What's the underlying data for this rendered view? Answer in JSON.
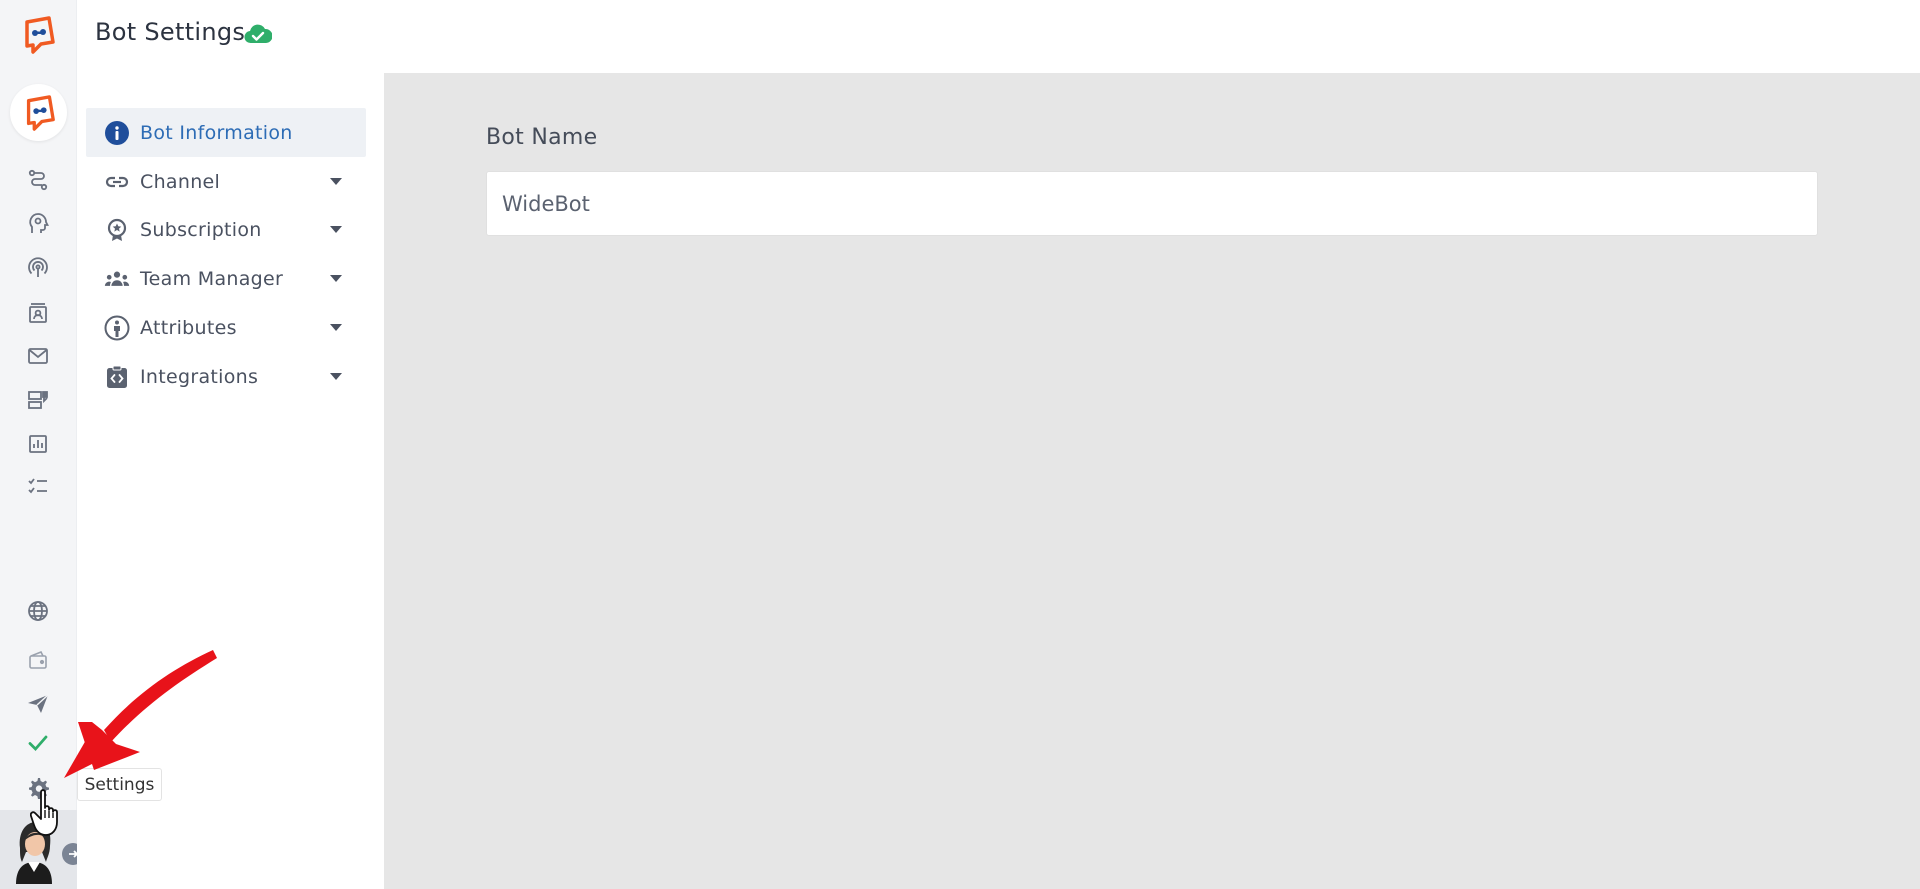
{
  "header": {
    "title": "Bot Settings"
  },
  "subnav": {
    "items": [
      {
        "label": "Bot Information"
      },
      {
        "label": "Channel"
      },
      {
        "label": "Subscription"
      },
      {
        "label": "Team Manager"
      },
      {
        "label": "Attributes"
      },
      {
        "label": "Integrations"
      }
    ]
  },
  "form": {
    "bot_name_label": "Bot Name",
    "bot_name_value": "WideBot"
  },
  "tooltip": {
    "text": "Settings"
  },
  "colors": {
    "brand_orange": "#f05a22",
    "brand_blue": "#1f4e9b",
    "active_nav_text": "#2d6cb5",
    "success_green": "#2fae6a",
    "annotation_red": "#e8131a",
    "content_bg": "#e6e6e6"
  },
  "rail": {
    "icons": [
      "flow-icon",
      "brain-icon",
      "broadcast-icon",
      "contacts-icon",
      "mail-icon",
      "template-icon",
      "analytics-icon",
      "checklist-icon",
      "globe-icon",
      "wallet-icon",
      "send-icon",
      "check-icon",
      "settings-icon"
    ]
  }
}
